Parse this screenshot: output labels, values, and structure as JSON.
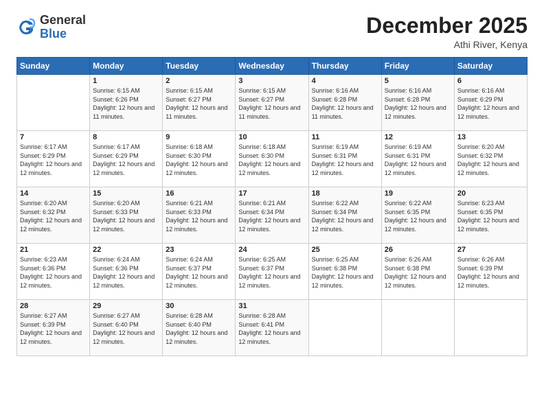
{
  "logo": {
    "general": "General",
    "blue": "Blue"
  },
  "header": {
    "month": "December 2025",
    "location": "Athi River, Kenya"
  },
  "weekdays": [
    "Sunday",
    "Monday",
    "Tuesday",
    "Wednesday",
    "Thursday",
    "Friday",
    "Saturday"
  ],
  "weeks": [
    [
      {
        "day": "",
        "sunrise": "",
        "sunset": "",
        "daylight": ""
      },
      {
        "day": "1",
        "sunrise": "Sunrise: 6:15 AM",
        "sunset": "Sunset: 6:26 PM",
        "daylight": "Daylight: 12 hours and 11 minutes."
      },
      {
        "day": "2",
        "sunrise": "Sunrise: 6:15 AM",
        "sunset": "Sunset: 6:27 PM",
        "daylight": "Daylight: 12 hours and 11 minutes."
      },
      {
        "day": "3",
        "sunrise": "Sunrise: 6:15 AM",
        "sunset": "Sunset: 6:27 PM",
        "daylight": "Daylight: 12 hours and 11 minutes."
      },
      {
        "day": "4",
        "sunrise": "Sunrise: 6:16 AM",
        "sunset": "Sunset: 6:28 PM",
        "daylight": "Daylight: 12 hours and 11 minutes."
      },
      {
        "day": "5",
        "sunrise": "Sunrise: 6:16 AM",
        "sunset": "Sunset: 6:28 PM",
        "daylight": "Daylight: 12 hours and 12 minutes."
      },
      {
        "day": "6",
        "sunrise": "Sunrise: 6:16 AM",
        "sunset": "Sunset: 6:29 PM",
        "daylight": "Daylight: 12 hours and 12 minutes."
      }
    ],
    [
      {
        "day": "7",
        "sunrise": "Sunrise: 6:17 AM",
        "sunset": "Sunset: 6:29 PM",
        "daylight": "Daylight: 12 hours and 12 minutes."
      },
      {
        "day": "8",
        "sunrise": "Sunrise: 6:17 AM",
        "sunset": "Sunset: 6:29 PM",
        "daylight": "Daylight: 12 hours and 12 minutes."
      },
      {
        "day": "9",
        "sunrise": "Sunrise: 6:18 AM",
        "sunset": "Sunset: 6:30 PM",
        "daylight": "Daylight: 12 hours and 12 minutes."
      },
      {
        "day": "10",
        "sunrise": "Sunrise: 6:18 AM",
        "sunset": "Sunset: 6:30 PM",
        "daylight": "Daylight: 12 hours and 12 minutes."
      },
      {
        "day": "11",
        "sunrise": "Sunrise: 6:19 AM",
        "sunset": "Sunset: 6:31 PM",
        "daylight": "Daylight: 12 hours and 12 minutes."
      },
      {
        "day": "12",
        "sunrise": "Sunrise: 6:19 AM",
        "sunset": "Sunset: 6:31 PM",
        "daylight": "Daylight: 12 hours and 12 minutes."
      },
      {
        "day": "13",
        "sunrise": "Sunrise: 6:20 AM",
        "sunset": "Sunset: 6:32 PM",
        "daylight": "Daylight: 12 hours and 12 minutes."
      }
    ],
    [
      {
        "day": "14",
        "sunrise": "Sunrise: 6:20 AM",
        "sunset": "Sunset: 6:32 PM",
        "daylight": "Daylight: 12 hours and 12 minutes."
      },
      {
        "day": "15",
        "sunrise": "Sunrise: 6:20 AM",
        "sunset": "Sunset: 6:33 PM",
        "daylight": "Daylight: 12 hours and 12 minutes."
      },
      {
        "day": "16",
        "sunrise": "Sunrise: 6:21 AM",
        "sunset": "Sunset: 6:33 PM",
        "daylight": "Daylight: 12 hours and 12 minutes."
      },
      {
        "day": "17",
        "sunrise": "Sunrise: 6:21 AM",
        "sunset": "Sunset: 6:34 PM",
        "daylight": "Daylight: 12 hours and 12 minutes."
      },
      {
        "day": "18",
        "sunrise": "Sunrise: 6:22 AM",
        "sunset": "Sunset: 6:34 PM",
        "daylight": "Daylight: 12 hours and 12 minutes."
      },
      {
        "day": "19",
        "sunrise": "Sunrise: 6:22 AM",
        "sunset": "Sunset: 6:35 PM",
        "daylight": "Daylight: 12 hours and 12 minutes."
      },
      {
        "day": "20",
        "sunrise": "Sunrise: 6:23 AM",
        "sunset": "Sunset: 6:35 PM",
        "daylight": "Daylight: 12 hours and 12 minutes."
      }
    ],
    [
      {
        "day": "21",
        "sunrise": "Sunrise: 6:23 AM",
        "sunset": "Sunset: 6:36 PM",
        "daylight": "Daylight: 12 hours and 12 minutes."
      },
      {
        "day": "22",
        "sunrise": "Sunrise: 6:24 AM",
        "sunset": "Sunset: 6:36 PM",
        "daylight": "Daylight: 12 hours and 12 minutes."
      },
      {
        "day": "23",
        "sunrise": "Sunrise: 6:24 AM",
        "sunset": "Sunset: 6:37 PM",
        "daylight": "Daylight: 12 hours and 12 minutes."
      },
      {
        "day": "24",
        "sunrise": "Sunrise: 6:25 AM",
        "sunset": "Sunset: 6:37 PM",
        "daylight": "Daylight: 12 hours and 12 minutes."
      },
      {
        "day": "25",
        "sunrise": "Sunrise: 6:25 AM",
        "sunset": "Sunset: 6:38 PM",
        "daylight": "Daylight: 12 hours and 12 minutes."
      },
      {
        "day": "26",
        "sunrise": "Sunrise: 6:26 AM",
        "sunset": "Sunset: 6:38 PM",
        "daylight": "Daylight: 12 hours and 12 minutes."
      },
      {
        "day": "27",
        "sunrise": "Sunrise: 6:26 AM",
        "sunset": "Sunset: 6:39 PM",
        "daylight": "Daylight: 12 hours and 12 minutes."
      }
    ],
    [
      {
        "day": "28",
        "sunrise": "Sunrise: 6:27 AM",
        "sunset": "Sunset: 6:39 PM",
        "daylight": "Daylight: 12 hours and 12 minutes."
      },
      {
        "day": "29",
        "sunrise": "Sunrise: 6:27 AM",
        "sunset": "Sunset: 6:40 PM",
        "daylight": "Daylight: 12 hours and 12 minutes."
      },
      {
        "day": "30",
        "sunrise": "Sunrise: 6:28 AM",
        "sunset": "Sunset: 6:40 PM",
        "daylight": "Daylight: 12 hours and 12 minutes."
      },
      {
        "day": "31",
        "sunrise": "Sunrise: 6:28 AM",
        "sunset": "Sunset: 6:41 PM",
        "daylight": "Daylight: 12 hours and 12 minutes."
      },
      {
        "day": "",
        "sunrise": "",
        "sunset": "",
        "daylight": ""
      },
      {
        "day": "",
        "sunrise": "",
        "sunset": "",
        "daylight": ""
      },
      {
        "day": "",
        "sunrise": "",
        "sunset": "",
        "daylight": ""
      }
    ]
  ]
}
